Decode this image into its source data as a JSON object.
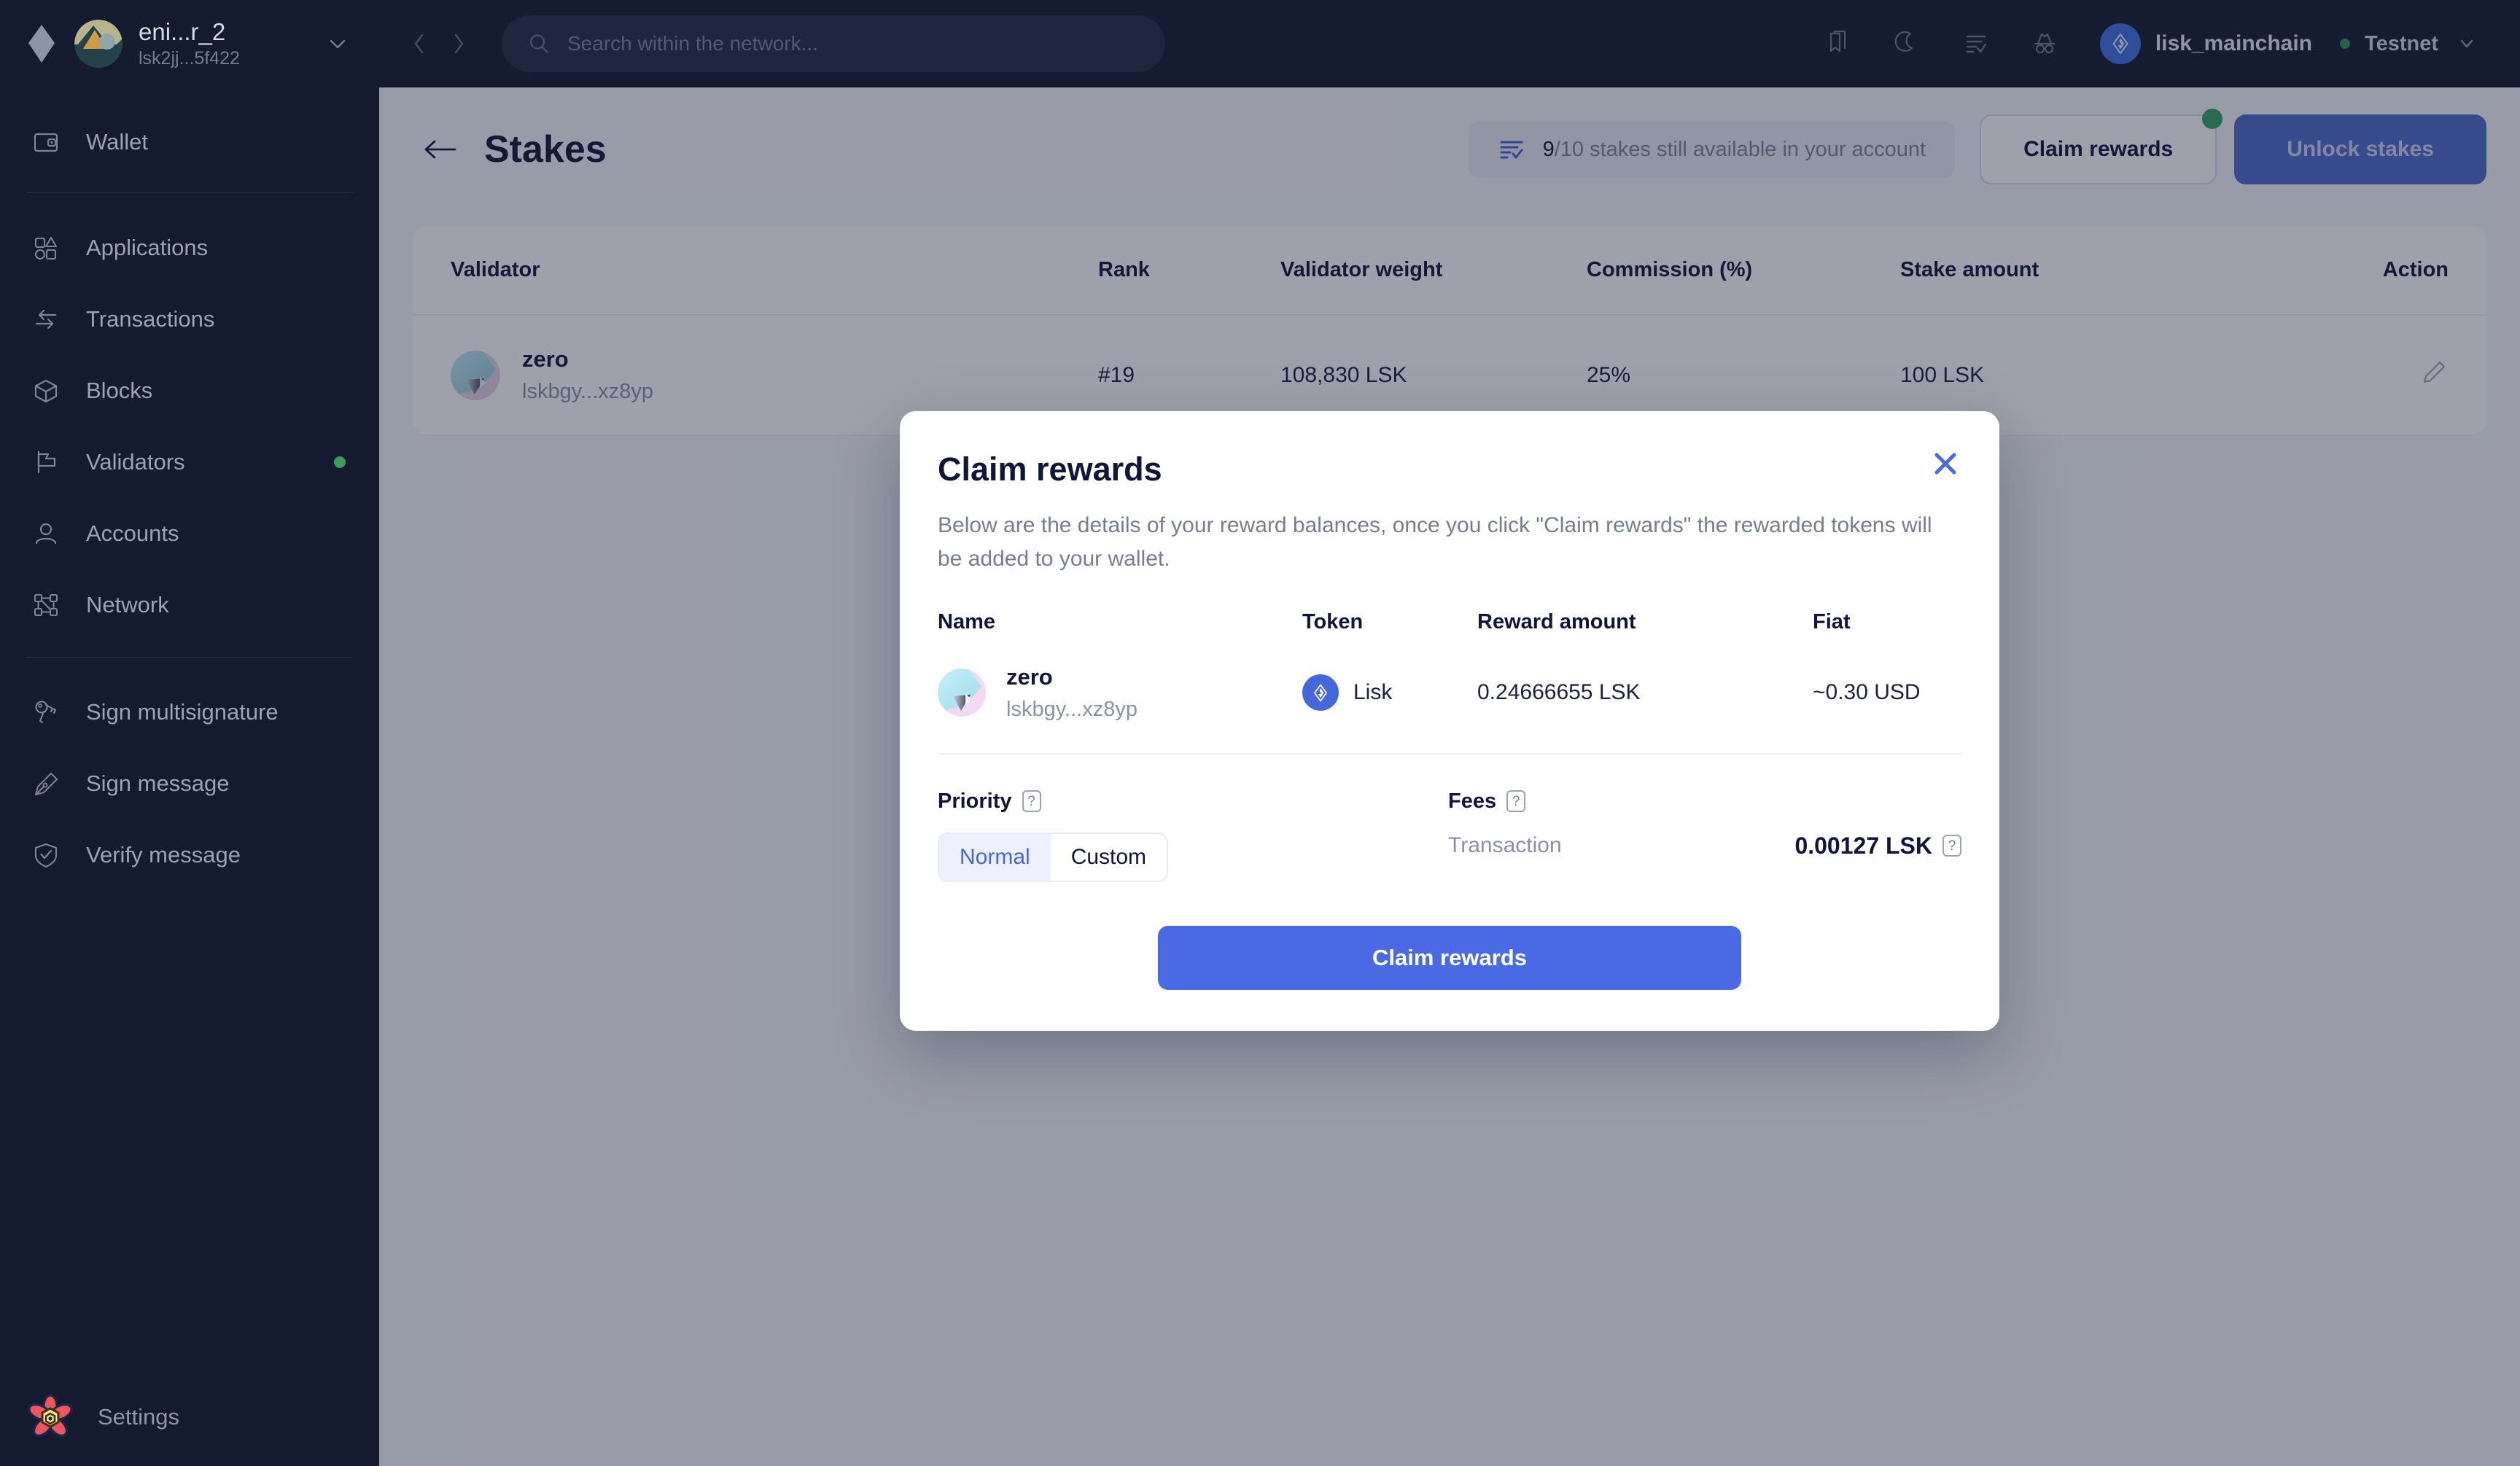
{
  "sidebar": {
    "account": {
      "name": "eni...r_2",
      "address": "lsk2jj...5f422"
    },
    "items": [
      {
        "label": "Wallet",
        "icon": "wallet-icon"
      },
      {
        "label": "Applications",
        "icon": "applications-icon"
      },
      {
        "label": "Transactions",
        "icon": "transactions-icon"
      },
      {
        "label": "Blocks",
        "icon": "blocks-icon"
      },
      {
        "label": "Validators",
        "icon": "validators-icon",
        "dot": true
      },
      {
        "label": "Accounts",
        "icon": "accounts-icon"
      },
      {
        "label": "Network",
        "icon": "network-icon"
      },
      {
        "label": "Sign multisignature",
        "icon": "keys-icon"
      },
      {
        "label": "Sign message",
        "icon": "pen-icon"
      },
      {
        "label": "Verify message",
        "icon": "shield-check-icon"
      }
    ],
    "settings_label": "Settings"
  },
  "topbar": {
    "search_placeholder": "Search within the network...",
    "chain_name": "lisk_mainchain",
    "network_label": "Testnet",
    "icons": [
      "bookmark-icon",
      "dark-mode-icon",
      "transactions-list-icon",
      "incognito-icon"
    ]
  },
  "page": {
    "title": "Stakes",
    "stakes_available_count": "9",
    "stakes_available_rest": "/10 stakes still available in your account",
    "claim_rewards_label": "Claim rewards",
    "unlock_stakes_label": "Unlock stakes"
  },
  "table": {
    "headers": [
      "Validator",
      "Rank",
      "Validator weight",
      "Commission (%)",
      "Stake amount",
      "Action"
    ],
    "rows": [
      {
        "name": "zero",
        "address": "lskbgy...xz8yp",
        "rank": "#19",
        "weight": "108,830 LSK",
        "commission": "25%",
        "stake": "100 LSK",
        "action_icon": "edit-pencil-icon"
      }
    ]
  },
  "modal": {
    "title": "Claim rewards",
    "description": "Below are the details of your reward balances, once you click \"Claim rewards\" the rewarded tokens will be added to your wallet.",
    "headers": [
      "Name",
      "Token",
      "Reward amount",
      "Fiat"
    ],
    "rows": [
      {
        "name": "zero",
        "address": "lskbgy...xz8yp",
        "token": "Lisk",
        "reward_amount": "0.24666655 LSK",
        "fiat": "~0.30 USD"
      }
    ],
    "priority_label": "Priority",
    "priority_options": [
      "Normal",
      "Custom"
    ],
    "priority_selected": "Normal",
    "fees_label": "Fees",
    "fee_name": "Transaction",
    "fee_value": "0.00127 LSK",
    "cta_label": "Claim rewards",
    "help_glyph": "?",
    "close_icon": "close-icon"
  },
  "colors": {
    "accent_blue": "#4a6ae4",
    "sidebar_bg": "#141a30",
    "main_bg": "#f5f6fa",
    "green_dot": "#35a361"
  }
}
